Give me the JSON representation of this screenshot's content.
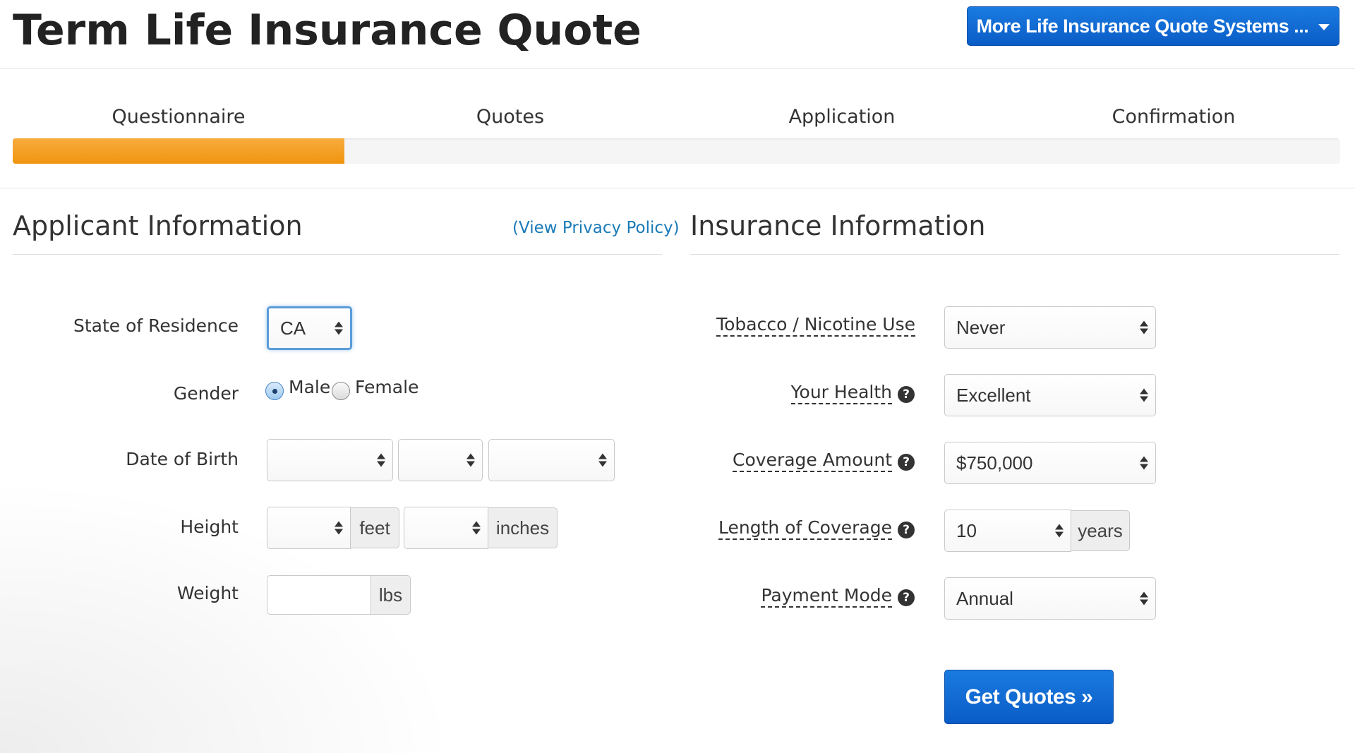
{
  "header": {
    "title": "Term Life Insurance Quote",
    "more_systems_label": "More Life Insurance Quote Systems ..."
  },
  "progress": {
    "steps": [
      "Questionnaire",
      "Quotes",
      "Application",
      "Confirmation"
    ],
    "current_step": 1,
    "fill_fraction": 0.25,
    "fill_color": "#f39a1c"
  },
  "applicant": {
    "title": "Applicant Information",
    "privacy_link": "(View Privacy Policy)",
    "state_label": "State of Residence",
    "state_value": "CA",
    "gender_label": "Gender",
    "gender_options": [
      "Male",
      "Female"
    ],
    "gender_selected": "Male",
    "dob_label": "Date of Birth",
    "height_label": "Height",
    "feet_unit": "feet",
    "inches_unit": "inches",
    "weight_label": "Weight",
    "weight_unit": "lbs"
  },
  "insurance": {
    "title": "Insurance Information",
    "tobacco_label": "Tobacco / Nicotine Use",
    "tobacco_value": "Never",
    "health_label": "Your Health",
    "health_value": "Excellent",
    "coverage_label": "Coverage Amount",
    "coverage_value": "$750,000",
    "length_label": "Length of Coverage",
    "length_value": "10",
    "length_unit": "years",
    "payment_label": "Payment Mode",
    "payment_value": "Annual"
  },
  "actions": {
    "get_quotes_label": "Get Quotes »"
  },
  "colors": {
    "primary_button": "#0f6ad4",
    "progress": "#f39a1c",
    "link": "#1a7ab8"
  },
  "icons": {
    "help": "question-circle-icon",
    "dropdown": "chevron-down-icon",
    "select_arrows": "up-down-arrows-icon"
  }
}
